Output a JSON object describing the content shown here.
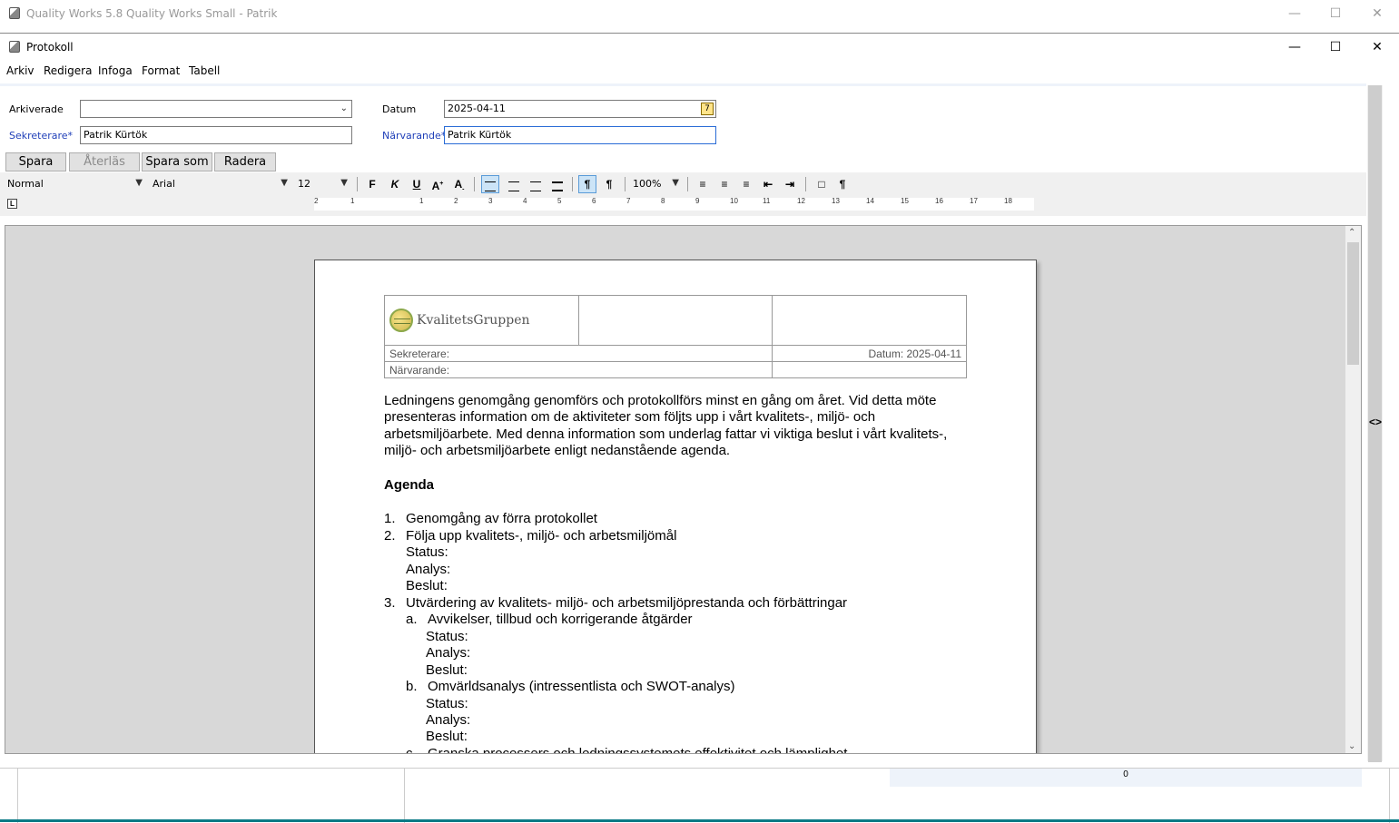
{
  "outer_window": {
    "title": "Quality Works 5.8 Quality Works Small - Patrik",
    "minimize": "—",
    "maximize": "☐",
    "close": "✕"
  },
  "inner_window": {
    "title": "Protokoll",
    "minimize": "—",
    "maximize": "☐",
    "close": "✕"
  },
  "menu": [
    "Arkiv",
    "Redigera",
    "Infoga",
    "Format",
    "Tabell"
  ],
  "form": {
    "arkiverade_label": "Arkiverade",
    "arkiverade_value": "",
    "datum_label": "Datum",
    "datum_value": "2025-04-11",
    "sekreterare_label": "Sekreterare*",
    "sekreterare_value": "Patrik Kürtök",
    "narvarande_label": "Närvarande*",
    "narvarande_value": "Patrik Kürtök"
  },
  "buttons": {
    "save": "Spara",
    "restore": "Återläs",
    "save_as": "Spara som",
    "delete": "Radera"
  },
  "toolbar": {
    "style": "Normal",
    "font": "Arial",
    "size": "12",
    "bold": "F",
    "italic": "K",
    "underline": "U",
    "zoom": "100%",
    "pilcrow": "¶"
  },
  "ruler": {
    "box": "L",
    "numbers": [
      "2",
      "1",
      "1",
      "2",
      "3",
      "4",
      "5",
      "6",
      "7",
      "8",
      "9",
      "10",
      "11",
      "12",
      "13",
      "14",
      "15",
      "16",
      "17",
      "18"
    ]
  },
  "document": {
    "logo_text": "KvalitetsGruppen",
    "header_sekreterare": "Sekreterare:",
    "header_datum": "Datum: 2025-04-11",
    "header_narvarande": "Närvarande:",
    "intro": "Ledningens genomgång genomförs och protokollförs minst en gång om året. Vid detta möte presenteras information om de aktiviteter som följts upp i vårt kvalitets-, miljö- och arbetsmiljöarbete. Med denna information som underlag fattar vi viktiga beslut i vårt kvalitets-, miljö- och arbetsmiljöarbete enligt nedanstående agenda.",
    "agenda_heading": "Agenda",
    "items": {
      "n1": "1.",
      "i1": "Genomgång av förra protokollet",
      "n2": "2.",
      "i2": "Följa upp kvalitets-, miljö- och arbetsmiljömål",
      "n3": "3.",
      "i3": "Utvärdering av kvalitets- miljö- och arbetsmiljöprestanda och förbättringar",
      "na": "a.",
      "ia": "Avvikelser, tillbud och korrigerande åtgärder",
      "nb": "b.",
      "ib": "Omvärldsanalys (intressentlista och SWOT-analys)",
      "nc": "c.",
      "ic": "Granska processers och ledningssystemets effektivitet och lämplighet",
      "status": "Status:",
      "analys": "Analys:",
      "beslut": "Beslut:"
    }
  },
  "status_bar": {
    "counter": "0"
  },
  "splitter": "<>"
}
